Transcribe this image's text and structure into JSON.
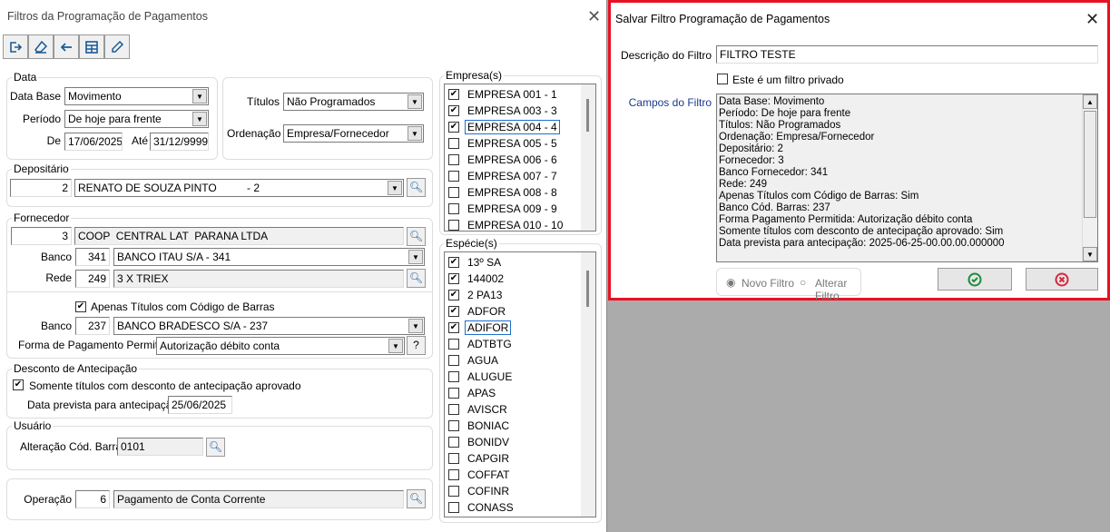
{
  "main": {
    "title": "Filtros da Programação de Pagamentos",
    "toolbar": [
      {
        "icon": "exit-icon"
      },
      {
        "icon": "eraser-icon"
      },
      {
        "icon": "back-arrow-icon"
      },
      {
        "icon": "table-icon"
      },
      {
        "icon": "pencil-icon"
      }
    ],
    "data": {
      "label": "Data",
      "data_base_label": "Data Base",
      "data_base": "Movimento",
      "periodo_label": "Período",
      "periodo": "De hoje para frente",
      "de_label": "De",
      "de": "17/06/2025",
      "ate_label": "Até",
      "ate": "31/12/9999"
    },
    "titulos": {
      "label": "Títulos",
      "value": "Não Programados",
      "ordenacao_label": "Ordenação",
      "ordenacao": "Empresa/Fornecedor"
    },
    "depositario": {
      "label": "Depositário",
      "code": "2",
      "name": "RENATO DE SOUZA PINTO          - 2"
    },
    "fornecedor": {
      "label": "Fornecedor",
      "code": "3",
      "name": "COOP  CENTRAL LAT  PARANA LTDA",
      "banco_label": "Banco",
      "banco_code": "341",
      "banco_name": "BANCO ITAU S/A - 341",
      "rede_label": "Rede",
      "rede_code": "249",
      "rede_name": "3 X TRIEX",
      "barras_label": "Apenas Títulos com Código de Barras",
      "barras_checked": true,
      "banco2_label": "Banco",
      "banco2_code": "237",
      "banco2_name": "BANCO BRADESCO S/A - 237",
      "forma_label": "Forma de Pagamento Permitida",
      "forma": "Autorização débito conta",
      "help": "?"
    },
    "desconto": {
      "label": "Desconto de Antecipação",
      "somente_label": "Somente títulos com desconto de antecipação aprovado",
      "somente_checked": true,
      "data_label": "Data prevista para antecipação",
      "data": "25/06/2025"
    },
    "usuario": {
      "label": "Usuário",
      "alteracao_label": "Alteração Cód. Barras",
      "alteracao": "0101"
    },
    "operacao": {
      "label": "Operação",
      "code": "6",
      "name": "Pagamento de Conta Corrente"
    },
    "empresas": {
      "label": "Empresa(s)",
      "items": [
        {
          "label": "EMPRESA 001 - 1",
          "checked": true
        },
        {
          "label": "EMPRESA 003 - 3",
          "checked": true
        },
        {
          "label": "EMPRESA 004 - 4",
          "checked": true,
          "focus": true
        },
        {
          "label": "EMPRESA 005 - 5",
          "checked": false
        },
        {
          "label": "EMPRESA 006 - 6",
          "checked": false
        },
        {
          "label": "EMPRESA 007 - 7",
          "checked": false
        },
        {
          "label": "EMPRESA 008 - 8",
          "checked": false
        },
        {
          "label": "EMPRESA 009 - 9",
          "checked": false
        },
        {
          "label": "EMPRESA 010 - 10",
          "checked": false
        }
      ]
    },
    "especies": {
      "label": "Espécie(s)",
      "items": [
        {
          "label": "13º SA",
          "checked": true
        },
        {
          "label": "144002",
          "checked": true
        },
        {
          "label": "2 PA13",
          "checked": true
        },
        {
          "label": "ADFOR",
          "checked": true
        },
        {
          "label": "ADIFOR",
          "checked": true,
          "focus": true
        },
        {
          "label": "ADTBTG",
          "checked": false
        },
        {
          "label": "AGUA",
          "checked": false
        },
        {
          "label": "ALUGUE",
          "checked": false
        },
        {
          "label": "APAS",
          "checked": false
        },
        {
          "label": "AVISCR",
          "checked": false
        },
        {
          "label": "BONIAC",
          "checked": false
        },
        {
          "label": "BONIDV",
          "checked": false
        },
        {
          "label": "CAPGIR",
          "checked": false
        },
        {
          "label": "COFFAT",
          "checked": false
        },
        {
          "label": "COFINR",
          "checked": false
        },
        {
          "label": "CONASS",
          "checked": false
        }
      ]
    }
  },
  "dialog": {
    "title": "Salvar Filtro Programação de Pagamentos",
    "descricao_label": "Descrição do Filtro",
    "descricao": "FILTRO TESTE",
    "privado_label": "Este é um filtro privado",
    "privado_checked": false,
    "campos_label": "Campos do Filtro",
    "campos": [
      "Data Base: Movimento",
      "Período: De hoje para frente",
      "Títulos: Não Programados",
      "Ordenação: Empresa/Fornecedor",
      "Depositário: 2",
      "Fornecedor: 3",
      "Banco Fornecedor: 341",
      "Rede: 249",
      "Apenas Títulos com Código de Barras: Sim",
      "Banco Cód. Barras: 237",
      "Forma Pagamento Permitida: Autorização débito conta",
      "Somente títulos com desconto de antecipação aprovado: Sim",
      "Data prevista para antecipação: 2025-06-25-00.00.00.000000"
    ],
    "novo_label": "Novo Filtro",
    "alterar_label": "Alterar Filtro",
    "novo_selected": true,
    "colors": {
      "border": "#e81123",
      "ok": "#1e8a3a",
      "cancel": "#d7263d"
    }
  }
}
